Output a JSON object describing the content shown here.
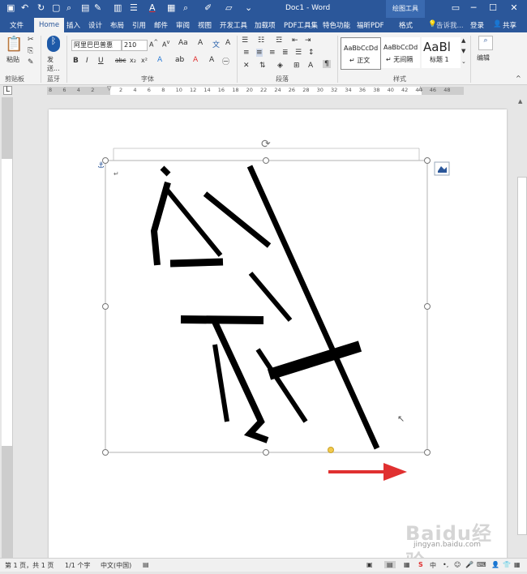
{
  "window": {
    "title": "Doc1 - Word",
    "context_tool": "绘图工具",
    "signin": "登录",
    "share": "共享",
    "tell_me": "告诉我..."
  },
  "tabs": [
    "文件",
    "Home",
    "插入",
    "设计",
    "布局",
    "引用",
    "邮件",
    "审阅",
    "视图",
    "开发工具",
    "加载项",
    "PDF工具集",
    "特色功能",
    "福昕PDF",
    "格式"
  ],
  "ribbon": {
    "paste": "粘贴",
    "send": "发送...",
    "font_name": "阿里巴巴普惠",
    "font_size": "210",
    "styles": [
      {
        "preview": "AaBbCcDd",
        "name": "↵ 正文"
      },
      {
        "preview": "AaBbCcDd",
        "name": "↵ 无间隔"
      },
      {
        "preview": "AaBl",
        "name": "标题 1"
      }
    ],
    "edit": "编辑",
    "groups": {
      "clipboard": "剪贴板",
      "bluetooth": "蓝牙",
      "font": "字体",
      "paragraph": "段落",
      "styles": "样式"
    }
  },
  "ruler_numbers": [
    "8",
    "6",
    "4",
    "2",
    "",
    "2",
    "4",
    "6",
    "8",
    "10",
    "12",
    "14",
    "16",
    "18",
    "20",
    "22",
    "24",
    "26",
    "28",
    "30",
    "32",
    "34",
    "36",
    "38",
    "40",
    "42",
    "44",
    "46",
    "48"
  ],
  "status": {
    "page": "第 1 页，共 1 页",
    "words": "1/1 个字",
    "language": "中文(中国)"
  },
  "watermark": {
    "logo": "Baidu经验",
    "url": "jingyan.baidu.com"
  },
  "colors": {
    "brand": "#2b579a",
    "arrow": "#e03030",
    "handle": "#f2c94c"
  }
}
